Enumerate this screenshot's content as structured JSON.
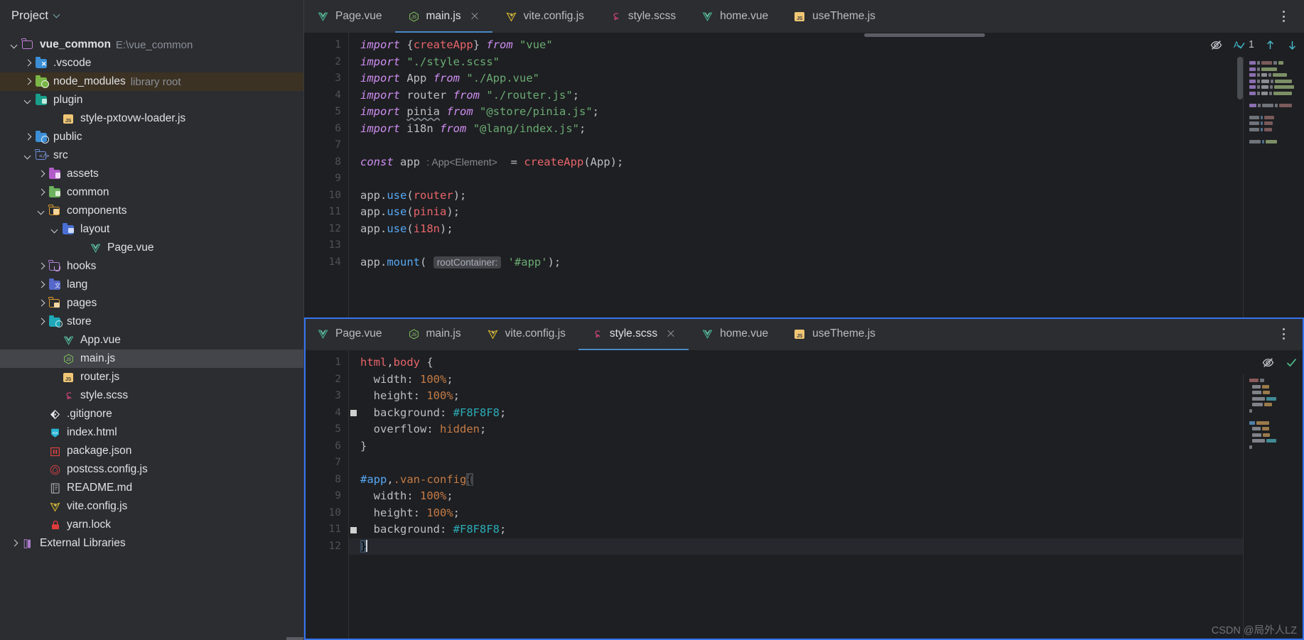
{
  "sidebar": {
    "title": "Project",
    "toggle_icon": "chevron-down-icon",
    "tree": [
      {
        "label": "vue_common",
        "suffix": "E:\\vue_common",
        "depth": 0,
        "arrow": "open",
        "icon": "folder-module-purple",
        "bold": true
      },
      {
        "label": ".vscode",
        "suffix": "",
        "depth": 1,
        "arrow": "closed",
        "icon": "folder-vscode"
      },
      {
        "label": "node_modules",
        "suffix": "library root",
        "depth": 1,
        "arrow": "closed",
        "icon": "folder-node",
        "highlight": "library"
      },
      {
        "label": "plugin",
        "suffix": "",
        "depth": 1,
        "arrow": "open",
        "icon": "folder-plugin"
      },
      {
        "label": "style-pxtovw-loader.js",
        "suffix": "",
        "depth": 3,
        "arrow": "none",
        "icon": "js-file"
      },
      {
        "label": "public",
        "suffix": "",
        "depth": 1,
        "arrow": "closed",
        "icon": "folder-public"
      },
      {
        "label": "src",
        "suffix": "",
        "depth": 1,
        "arrow": "open",
        "icon": "folder-source"
      },
      {
        "label": "assets",
        "suffix": "",
        "depth": 2,
        "arrow": "closed",
        "icon": "folder-assets"
      },
      {
        "label": "common",
        "suffix": "",
        "depth": 2,
        "arrow": "closed",
        "icon": "folder-green"
      },
      {
        "label": "components",
        "suffix": "",
        "depth": 2,
        "arrow": "open",
        "icon": "folder-components"
      },
      {
        "label": "layout",
        "suffix": "",
        "depth": 3,
        "arrow": "open",
        "icon": "folder-layout"
      },
      {
        "label": "Page.vue",
        "suffix": "",
        "depth": 5,
        "arrow": "none",
        "icon": "vue-file"
      },
      {
        "label": "hooks",
        "suffix": "",
        "depth": 2,
        "arrow": "closed",
        "icon": "folder-hooks"
      },
      {
        "label": "lang",
        "suffix": "",
        "depth": 2,
        "arrow": "closed",
        "icon": "folder-lang"
      },
      {
        "label": "pages",
        "suffix": "",
        "depth": 2,
        "arrow": "closed",
        "icon": "folder-pages"
      },
      {
        "label": "store",
        "suffix": "",
        "depth": 2,
        "arrow": "closed",
        "icon": "folder-store"
      },
      {
        "label": "App.vue",
        "suffix": "",
        "depth": 3,
        "arrow": "none",
        "icon": "vue-file"
      },
      {
        "label": "main.js",
        "suffix": "",
        "depth": 3,
        "arrow": "none",
        "icon": "node-js-file",
        "selected": true
      },
      {
        "label": "router.js",
        "suffix": "",
        "depth": 3,
        "arrow": "none",
        "icon": "js-file"
      },
      {
        "label": "style.scss",
        "suffix": "",
        "depth": 3,
        "arrow": "none",
        "icon": "scss-file"
      },
      {
        "label": ".gitignore",
        "suffix": "",
        "depth": 2,
        "arrow": "none",
        "icon": "git-file"
      },
      {
        "label": "index.html",
        "suffix": "",
        "depth": 2,
        "arrow": "none",
        "icon": "html-file"
      },
      {
        "label": "package.json",
        "suffix": "",
        "depth": 2,
        "arrow": "none",
        "icon": "npm-file"
      },
      {
        "label": "postcss.config.js",
        "suffix": "",
        "depth": 2,
        "arrow": "none",
        "icon": "postcss-file"
      },
      {
        "label": "README.md",
        "suffix": "",
        "depth": 2,
        "arrow": "none",
        "icon": "markdown-file"
      },
      {
        "label": "vite.config.js",
        "suffix": "",
        "depth": 2,
        "arrow": "none",
        "icon": "vite-file"
      },
      {
        "label": "yarn.lock",
        "suffix": "",
        "depth": 2,
        "arrow": "none",
        "icon": "lock-file"
      },
      {
        "label": "External Libraries",
        "suffix": "",
        "depth": 0,
        "arrow": "closed",
        "icon": "libraries"
      }
    ]
  },
  "top_editor": {
    "tabs": [
      {
        "label": "Page.vue",
        "icon": "vue-file",
        "active": false,
        "closable": false
      },
      {
        "label": "main.js",
        "icon": "node-js-file",
        "active": true,
        "closable": true
      },
      {
        "label": "vite.config.js",
        "icon": "vite-file",
        "active": false,
        "closable": false
      },
      {
        "label": "style.scss",
        "icon": "scss-file",
        "active": false,
        "closable": false
      },
      {
        "label": "home.vue",
        "icon": "vue-file",
        "active": false,
        "closable": false
      },
      {
        "label": "useTheme.js",
        "icon": "js-file",
        "active": false,
        "closable": false
      }
    ],
    "options_icon": "kebab-menu-icon",
    "widgets": {
      "hide_icon": "eye-crossed-icon",
      "inspections_icon": "inspections-checkmark-icon",
      "inspection_count": "1",
      "prev_icon": "arrow-up-icon",
      "next_icon": "arrow-down-icon"
    },
    "line_numbers": [
      "1",
      "2",
      "3",
      "4",
      "5",
      "6",
      "7",
      "8",
      "9",
      "10",
      "11",
      "12",
      "13",
      "14"
    ],
    "lines": [
      [
        {
          "t": "import",
          "c": "kw"
        },
        {
          "t": " ",
          "c": "punct"
        },
        {
          "t": "{",
          "c": "brace"
        },
        {
          "t": "createApp",
          "c": "tagc"
        },
        {
          "t": "}",
          "c": "brace"
        },
        {
          "t": " ",
          "c": "punct"
        },
        {
          "t": "from",
          "c": "kw"
        },
        {
          "t": " ",
          "c": "punct"
        },
        {
          "t": "\"vue\"",
          "c": "str"
        }
      ],
      [
        {
          "t": "import",
          "c": "kw"
        },
        {
          "t": " ",
          "c": "punct"
        },
        {
          "t": "\"./style.scss\"",
          "c": "str"
        }
      ],
      [
        {
          "t": "import",
          "c": "kw"
        },
        {
          "t": " ",
          "c": "punct"
        },
        {
          "t": "App",
          "c": "id"
        },
        {
          "t": " ",
          "c": "punct"
        },
        {
          "t": "from",
          "c": "kw"
        },
        {
          "t": " ",
          "c": "punct"
        },
        {
          "t": "\"./App.vue\"",
          "c": "str"
        }
      ],
      [
        {
          "t": "import",
          "c": "kw"
        },
        {
          "t": " ",
          "c": "punct"
        },
        {
          "t": "router",
          "c": "id"
        },
        {
          "t": " ",
          "c": "punct"
        },
        {
          "t": "from",
          "c": "kw"
        },
        {
          "t": " ",
          "c": "punct"
        },
        {
          "t": "\"./router.js\"",
          "c": "str"
        },
        {
          "t": ";",
          "c": "punct"
        }
      ],
      [
        {
          "t": "import",
          "c": "kw"
        },
        {
          "t": " ",
          "c": "punct"
        },
        {
          "t": "pinia",
          "c": "id squiggle"
        },
        {
          "t": " ",
          "c": "punct"
        },
        {
          "t": "from",
          "c": "kw"
        },
        {
          "t": " ",
          "c": "punct"
        },
        {
          "t": "\"@store/pinia.js\"",
          "c": "str"
        },
        {
          "t": ";",
          "c": "punct"
        }
      ],
      [
        {
          "t": "import",
          "c": "kw"
        },
        {
          "t": " ",
          "c": "punct"
        },
        {
          "t": "i18n",
          "c": "id"
        },
        {
          "t": " ",
          "c": "punct"
        },
        {
          "t": "from",
          "c": "kw"
        },
        {
          "t": " ",
          "c": "punct"
        },
        {
          "t": "\"@lang/index.js\"",
          "c": "str"
        },
        {
          "t": ";",
          "c": "punct"
        }
      ],
      [],
      [
        {
          "t": "const",
          "c": "kw"
        },
        {
          "t": " app ",
          "c": "id"
        },
        {
          "t": ": App<Element>",
          "c": "hint"
        },
        {
          "t": "  = ",
          "c": "punct"
        },
        {
          "t": "createApp",
          "c": "tagc"
        },
        {
          "t": "(",
          "c": "punct"
        },
        {
          "t": "App",
          "c": "id"
        },
        {
          "t": ");",
          "c": "punct"
        }
      ],
      [],
      [
        {
          "t": "app",
          "c": "prop"
        },
        {
          "t": ".",
          "c": "punct"
        },
        {
          "t": "use",
          "c": "fn"
        },
        {
          "t": "(",
          "c": "punct"
        },
        {
          "t": "router",
          "c": "tagc"
        },
        {
          "t": ");",
          "c": "punct"
        }
      ],
      [
        {
          "t": "app",
          "c": "prop"
        },
        {
          "t": ".",
          "c": "punct"
        },
        {
          "t": "use",
          "c": "fn"
        },
        {
          "t": "(",
          "c": "punct"
        },
        {
          "t": "pinia",
          "c": "tagc"
        },
        {
          "t": ");",
          "c": "punct"
        }
      ],
      [
        {
          "t": "app",
          "c": "prop"
        },
        {
          "t": ".",
          "c": "punct"
        },
        {
          "t": "use",
          "c": "fn"
        },
        {
          "t": "(",
          "c": "punct"
        },
        {
          "t": "i18n",
          "c": "tagc"
        },
        {
          "t": ");",
          "c": "punct"
        }
      ],
      [],
      [
        {
          "t": "app",
          "c": "prop"
        },
        {
          "t": ".",
          "c": "punct"
        },
        {
          "t": "mount",
          "c": "fn"
        },
        {
          "t": "( ",
          "c": "punct"
        },
        {
          "t": "rootContainer:",
          "c": "hint-box"
        },
        {
          "t": " ",
          "c": "punct"
        },
        {
          "t": "'#app'",
          "c": "str"
        },
        {
          "t": ");",
          "c": "punct"
        }
      ]
    ]
  },
  "bottom_editor": {
    "tabs": [
      {
        "label": "Page.vue",
        "icon": "vue-file",
        "active": false,
        "closable": false
      },
      {
        "label": "main.js",
        "icon": "node-js-file",
        "active": false,
        "closable": false
      },
      {
        "label": "vite.config.js",
        "icon": "vite-file",
        "active": false,
        "closable": false
      },
      {
        "label": "style.scss",
        "icon": "scss-file",
        "active": true,
        "closable": true
      },
      {
        "label": "home.vue",
        "icon": "vue-file",
        "active": false,
        "closable": false
      },
      {
        "label": "useTheme.js",
        "icon": "js-file",
        "active": false,
        "closable": false
      }
    ],
    "options_icon": "kebab-menu-icon",
    "widgets": {
      "hide_icon": "eye-crossed-icon",
      "ok_icon": "checkmark-icon"
    },
    "line_numbers": [
      "1",
      "2",
      "3",
      "4",
      "5",
      "6",
      "7",
      "8",
      "9",
      "10",
      "11",
      "12"
    ],
    "color_gutter_lines": [
      4,
      11
    ],
    "current_line": 12,
    "lines": [
      [
        {
          "t": "html",
          "c": "tagc"
        },
        {
          "t": ",",
          "c": "punct"
        },
        {
          "t": "body",
          "c": "tagc"
        },
        {
          "t": " ",
          "c": "punct"
        },
        {
          "t": "{",
          "c": "punct"
        }
      ],
      [
        {
          "t": "  ",
          "c": "punct"
        },
        {
          "t": "width",
          "c": "prop"
        },
        {
          "t": ": ",
          "c": "punct"
        },
        {
          "t": "100%",
          "c": "val"
        },
        {
          "t": ";",
          "c": "punct"
        }
      ],
      [
        {
          "t": "  ",
          "c": "punct"
        },
        {
          "t": "height",
          "c": "prop"
        },
        {
          "t": ": ",
          "c": "punct"
        },
        {
          "t": "100%",
          "c": "val"
        },
        {
          "t": ";",
          "c": "punct"
        }
      ],
      [
        {
          "t": "  ",
          "c": "punct"
        },
        {
          "t": "background",
          "c": "prop"
        },
        {
          "t": ": ",
          "c": "punct"
        },
        {
          "t": "#F8F8F8",
          "c": "hexv"
        },
        {
          "t": ";",
          "c": "punct"
        }
      ],
      [
        {
          "t": "  ",
          "c": "punct"
        },
        {
          "t": "overflow",
          "c": "prop"
        },
        {
          "t": ": ",
          "c": "punct"
        },
        {
          "t": "hidden",
          "c": "val"
        },
        {
          "t": ";",
          "c": "punct"
        }
      ],
      [
        {
          "t": "}",
          "c": "punct"
        }
      ],
      [],
      [
        {
          "t": "#app",
          "c": "fn"
        },
        {
          "t": ",",
          "c": "punct"
        },
        {
          "t": ".van-config",
          "c": "val"
        },
        {
          "t": "{",
          "c": "match-brace"
        }
      ],
      [
        {
          "t": "  ",
          "c": "punct"
        },
        {
          "t": "width",
          "c": "prop"
        },
        {
          "t": ": ",
          "c": "punct"
        },
        {
          "t": "100%",
          "c": "val"
        },
        {
          "t": ";",
          "c": "punct"
        }
      ],
      [
        {
          "t": "  ",
          "c": "punct"
        },
        {
          "t": "height",
          "c": "prop"
        },
        {
          "t": ": ",
          "c": "punct"
        },
        {
          "t": "100%",
          "c": "val"
        },
        {
          "t": ";",
          "c": "punct"
        }
      ],
      [
        {
          "t": "  ",
          "c": "punct"
        },
        {
          "t": "background",
          "c": "prop"
        },
        {
          "t": ": ",
          "c": "punct"
        },
        {
          "t": "#F8F8F8",
          "c": "hexv"
        },
        {
          "t": ";",
          "c": "punct"
        }
      ],
      [
        {
          "t": "}",
          "c": "sel-brace"
        }
      ]
    ]
  },
  "watermark": "CSDN @局外人LZ",
  "colors": {
    "accent_blue": "#3574f0",
    "tab_underline": "#4a88c7",
    "editor_bg": "#1e1f22",
    "panel_bg": "#2b2d30",
    "selection": "#43454a",
    "library_row": "#3c3223"
  }
}
